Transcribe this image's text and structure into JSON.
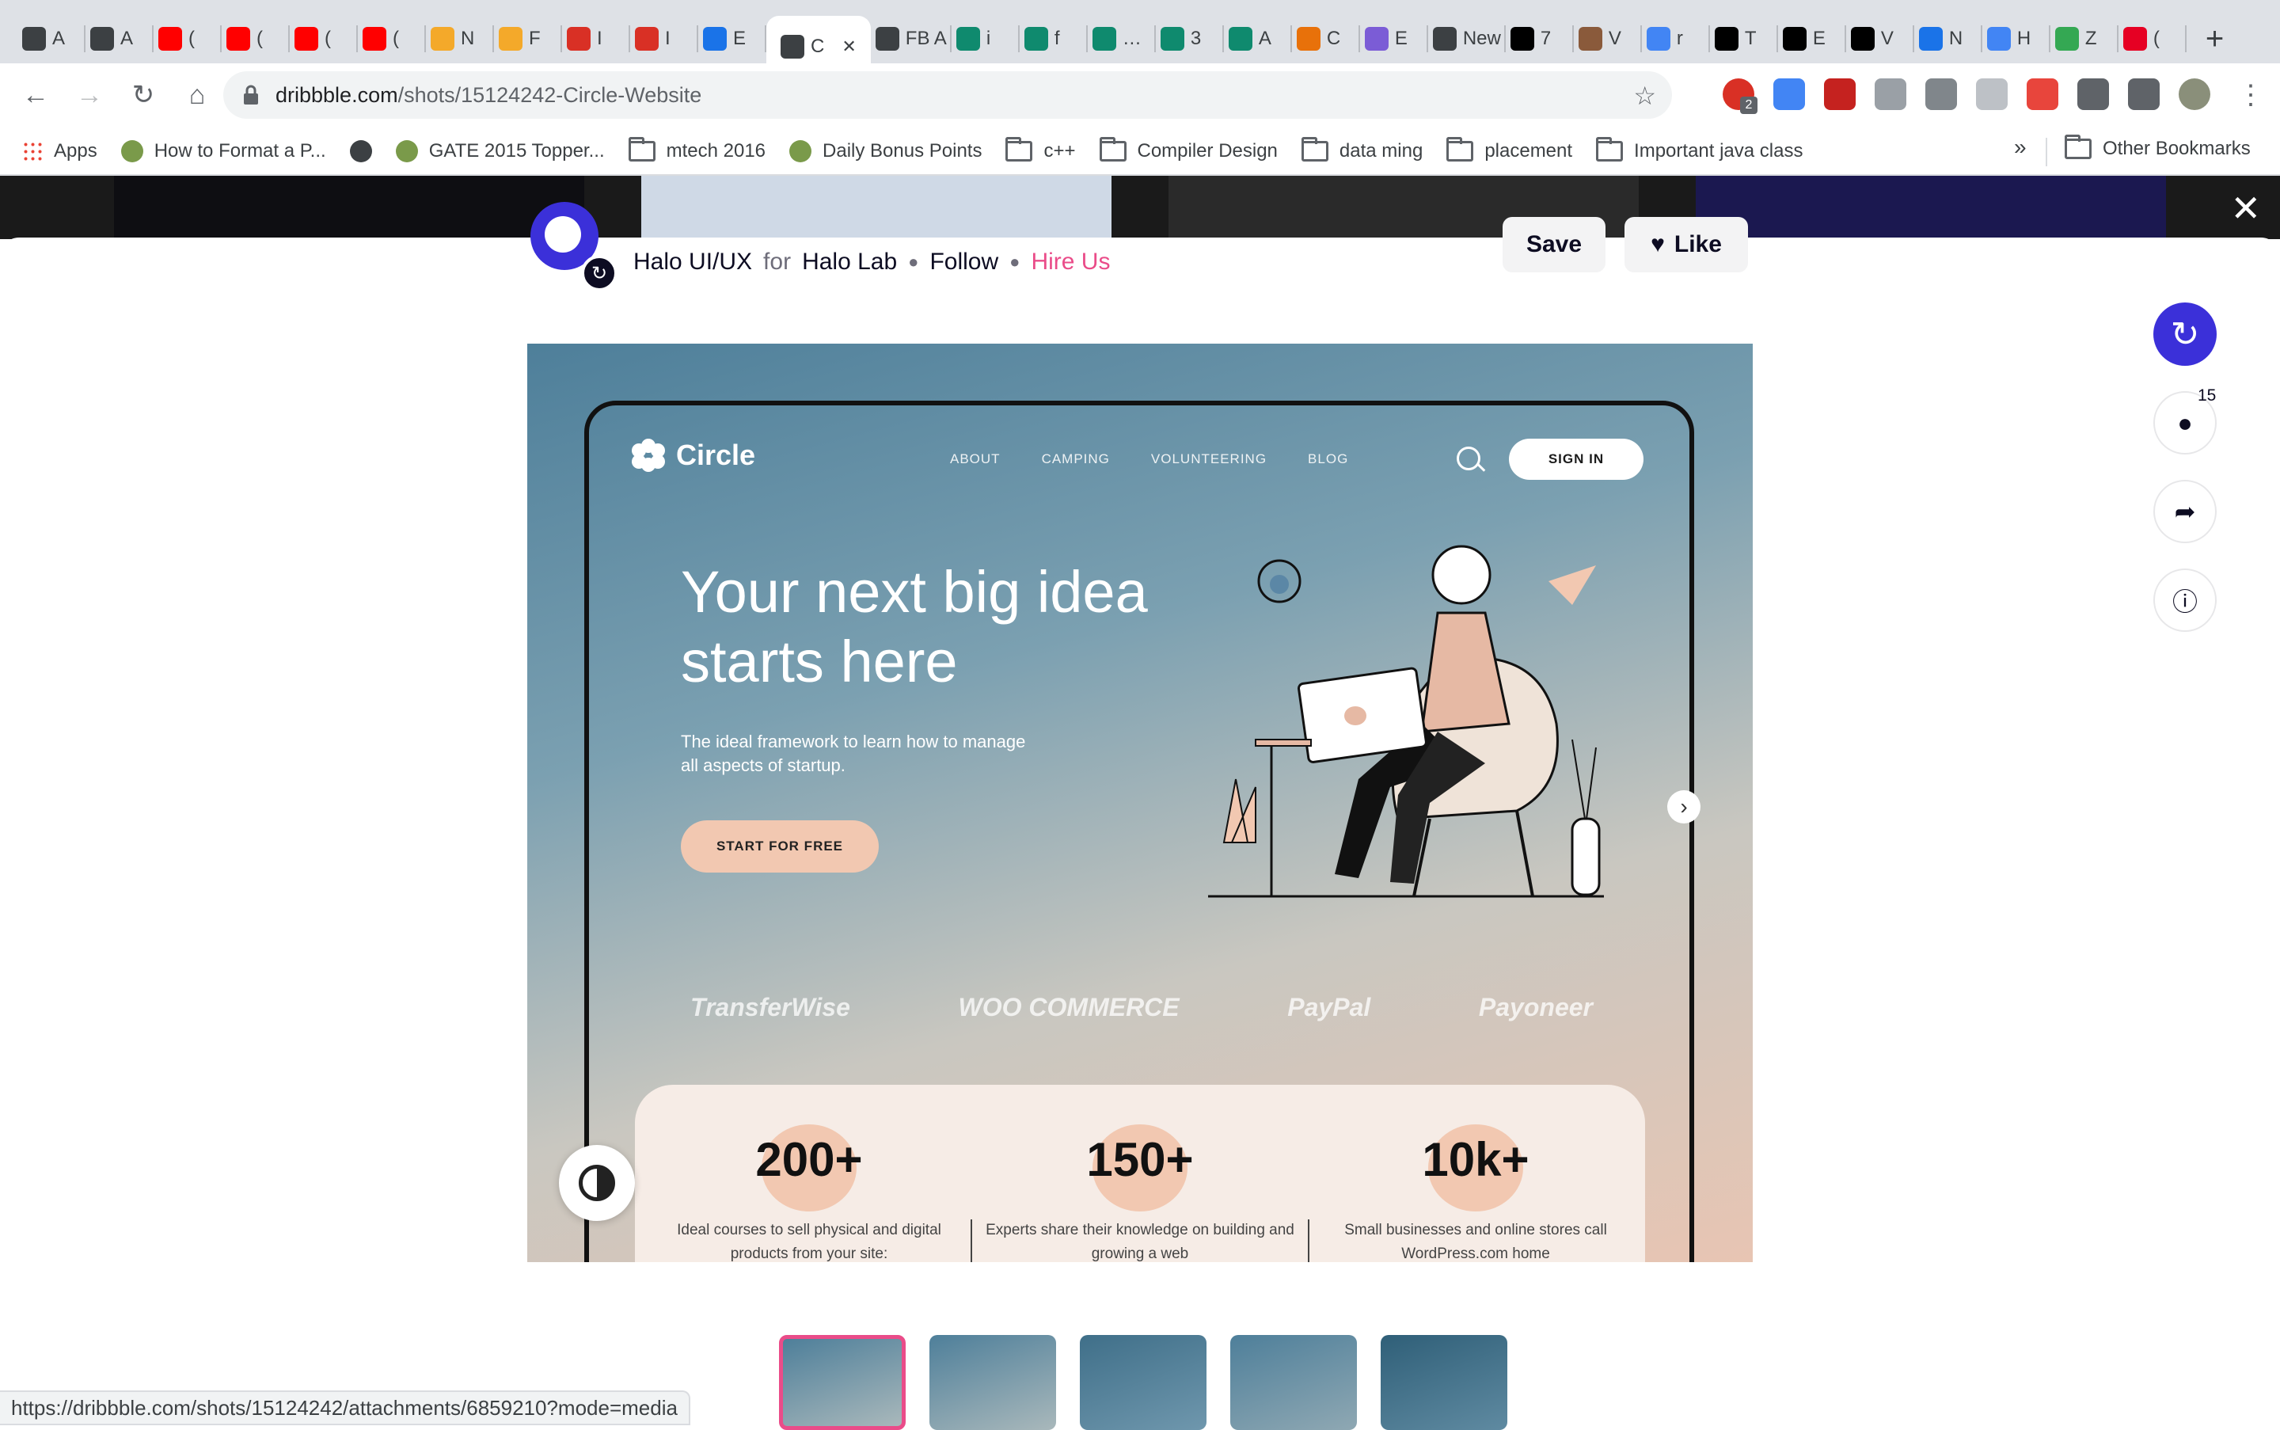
{
  "browser": {
    "tabs": [
      {
        "icon": "apple-icon",
        "label": "A",
        "color": "#3c4043"
      },
      {
        "icon": "apple-icon",
        "label": "A",
        "color": "#3c4043"
      },
      {
        "icon": "youtube-icon",
        "label": "(",
        "color": "#ff0000"
      },
      {
        "icon": "youtube-icon",
        "label": "(",
        "color": "#ff0000"
      },
      {
        "icon": "youtube-icon",
        "label": "(",
        "color": "#ff0000"
      },
      {
        "icon": "youtube-icon",
        "label": "(",
        "color": "#ff0000"
      },
      {
        "icon": "flame-icon",
        "label": "N",
        "color": "#f4a92a"
      },
      {
        "icon": "flame-icon",
        "label": "F",
        "color": "#f4a92a"
      },
      {
        "icon": "gmail-icon",
        "label": "I",
        "color": "#d93025"
      },
      {
        "icon": "gmail-icon",
        "label": "I",
        "color": "#d93025"
      },
      {
        "icon": "appstore-icon",
        "label": "E",
        "color": "#1a73e8"
      },
      {
        "icon": "dribbble-icon",
        "label": "C",
        "color": "#3c4043",
        "active": true
      },
      {
        "icon": "fb-icon",
        "label": "FB A",
        "color": "#3c4043"
      },
      {
        "icon": "openai-icon",
        "label": "i",
        "color": "#0f8a6e"
      },
      {
        "icon": "openai-icon",
        "label": "f",
        "color": "#0f8a6e"
      },
      {
        "icon": "openai-icon",
        "label": "…",
        "color": "#0f8a6e"
      },
      {
        "icon": "openai-icon",
        "label": "3",
        "color": "#0f8a6e"
      },
      {
        "icon": "openai-icon",
        "label": "A",
        "color": "#0f8a6e"
      },
      {
        "icon": "circle-icon",
        "label": "C",
        "color": "#e8710a"
      },
      {
        "icon": "spiral-icon",
        "label": "E",
        "color": "#7b5cd6"
      },
      {
        "icon": "blank-icon",
        "label": "New",
        "color": "#3c4043"
      },
      {
        "icon": "medium-icon",
        "label": "7",
        "color": "#000000"
      },
      {
        "icon": "avatar-icon",
        "label": "V",
        "color": "#8a5a3b"
      },
      {
        "icon": "google-icon",
        "label": "r",
        "color": "#4285f4"
      },
      {
        "icon": "medium-icon",
        "label": "T",
        "color": "#000000"
      },
      {
        "icon": "medium-icon",
        "label": "E",
        "color": "#000000"
      },
      {
        "icon": "medium-icon",
        "label": "V",
        "color": "#000000"
      },
      {
        "icon": "m-icon",
        "label": "N",
        "color": "#1a73e8"
      },
      {
        "icon": "google-icon",
        "label": "H",
        "color": "#4285f4"
      },
      {
        "icon": "n-icon",
        "label": "Z",
        "color": "#34a853"
      },
      {
        "icon": "pinterest-icon",
        "label": "(",
        "color": "#e60023"
      }
    ],
    "url_host": "dribbble.com",
    "url_path": "/shots/15124242-Circle-Website",
    "bookmarks": [
      {
        "type": "apps",
        "label": "Apps"
      },
      {
        "type": "site",
        "label": "How to Format a P..."
      },
      {
        "type": "globe",
        "label": ""
      },
      {
        "type": "site",
        "label": "GATE 2015 Topper..."
      },
      {
        "type": "folder",
        "label": "mtech 2016"
      },
      {
        "type": "site",
        "label": "Daily Bonus Points"
      },
      {
        "type": "folder",
        "label": "c++"
      },
      {
        "type": "folder",
        "label": "Compiler Design"
      },
      {
        "type": "folder",
        "label": "data ming"
      },
      {
        "type": "folder",
        "label": "placement"
      },
      {
        "type": "folder",
        "label": "Important java class"
      }
    ],
    "more_bookmarks": "»",
    "other_bookmarks": "Other Bookmarks",
    "extension_badge": "2",
    "status_url": "https://dribbble.com/shots/15124242/attachments/6859210?mode=media"
  },
  "shot": {
    "author": "Halo UI/UX",
    "for": "for",
    "team": "Halo Lab",
    "follow": "Follow",
    "hire": "Hire Us",
    "save": "Save",
    "like": "Like",
    "comment_count": "15"
  },
  "artwork": {
    "logo": "Circle",
    "nav": [
      "ABOUT",
      "CAMPING",
      "VOLUNTEERING",
      "BLOG"
    ],
    "sign_in": "SIGN IN",
    "headline": "Your next big idea starts here",
    "subtitle": "The ideal framework to learn how to manage all aspects of startup.",
    "cta": "START FOR FREE",
    "brands": [
      "TransferWise",
      "WOO COMMERCE",
      "PayPal",
      "Payoneer"
    ],
    "stats": [
      {
        "value": "200+",
        "desc": "Ideal courses to sell physical and digital products from your site:"
      },
      {
        "value": "150+",
        "desc": "Experts share their knowledge on building and growing a web"
      },
      {
        "value": "10k+",
        "desc": "Small businesses and online stores call WordPress.com home"
      }
    ]
  }
}
